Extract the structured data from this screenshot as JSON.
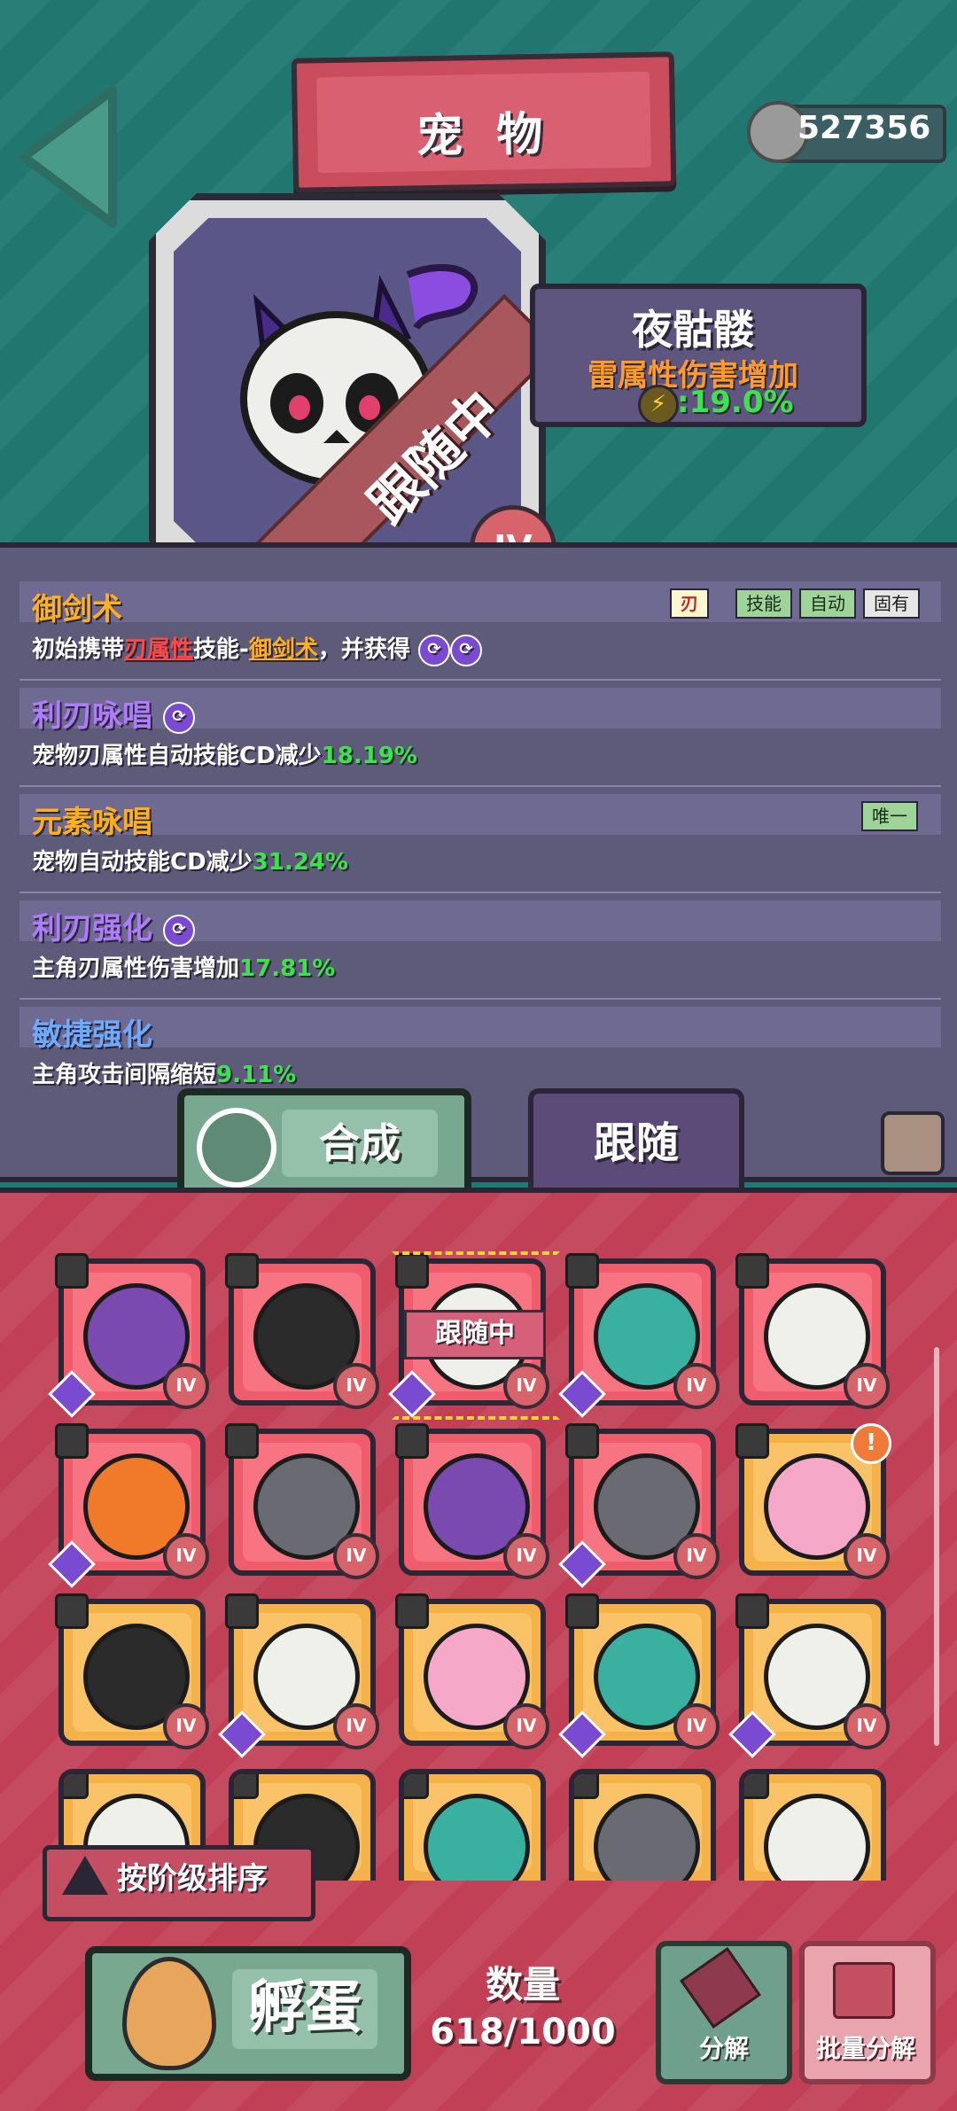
{
  "header": {
    "title": "宠 物",
    "coins": "527356"
  },
  "pet": {
    "name": "夜骷髅",
    "status_ribbon": "跟随中",
    "rank": "IV",
    "attribute_label": "雷属性伤害增加",
    "attribute_value": ":19.0%"
  },
  "skills": [
    {
      "name": "御剑术",
      "color": "#ffb020",
      "tags": [
        "刃",
        "技能",
        "自动",
        "固有"
      ],
      "desc_prefix": "初始携带",
      "desc_a": "刃属性",
      "desc_mid": "技能-",
      "desc_b": "御剑术",
      "desc_suffix": "，并获得"
    },
    {
      "name": "利刃咏唱",
      "color": "#b07cff",
      "desc_prefix": "宠物刃属性自动技能CD减少",
      "value": "18.19%"
    },
    {
      "name": "元素咏唱",
      "color": "#ffb020",
      "tags": [
        "唯一"
      ],
      "desc_prefix": "宠物自动技能CD减少",
      "value": "31.24%"
    },
    {
      "name": "利刃强化",
      "color": "#b07cff",
      "desc_prefix": "主角刃属性伤害增加",
      "value": "17.81%"
    },
    {
      "name": "敏捷强化",
      "color": "#6eaaff",
      "desc_prefix": "主角攻击间隔缩短",
      "value": "9.11%"
    }
  ],
  "actions": {
    "synthesize": "合成",
    "follow": "跟随"
  },
  "grid": {
    "following_label": "跟随中",
    "rank_label": "IV",
    "alert_mark": "!",
    "slots": [
      {
        "pet": "purple-dragon-icon",
        "bg": "red",
        "gem": true
      },
      {
        "pet": "sword-icon",
        "bg": "red",
        "gem": false
      },
      {
        "pet": "skull-icon",
        "bg": "red",
        "gem": true,
        "following": true
      },
      {
        "pet": "spring-creature-icon",
        "bg": "red",
        "gem": true
      },
      {
        "pet": "skull-icon",
        "bg": "red",
        "gem": false
      },
      {
        "pet": "pumpkin-icon",
        "bg": "red",
        "gem": true
      },
      {
        "pet": "drone-icon",
        "bg": "red",
        "gem": false
      },
      {
        "pet": "purple-dragon-icon",
        "bg": "red",
        "gem": false
      },
      {
        "pet": "drone-icon",
        "bg": "red",
        "gem": true
      },
      {
        "pet": "fairy-icon",
        "bg": "gold",
        "gem": false,
        "alert": true
      },
      {
        "pet": "sword-icon",
        "bg": "gold",
        "gem": false
      },
      {
        "pet": "skull-icon",
        "bg": "gold",
        "gem": true
      },
      {
        "pet": "fairy-icon",
        "bg": "gold",
        "gem": false
      },
      {
        "pet": "spring-creature-icon",
        "bg": "gold",
        "gem": true
      },
      {
        "pet": "skull-icon",
        "bg": "gold",
        "gem": true
      },
      {
        "pet": "skull-icon",
        "bg": "gold",
        "gem": false
      },
      {
        "pet": "sword-icon",
        "bg": "gold",
        "gem": false
      },
      {
        "pet": "spring-creature-icon",
        "bg": "gold",
        "gem": false
      },
      {
        "pet": "drone-icon",
        "bg": "gold",
        "gem": false
      },
      {
        "pet": "skull-icon",
        "bg": "gold",
        "gem": false
      }
    ]
  },
  "bottom": {
    "sort_label": "按阶级排序",
    "hatch_label": "孵蛋",
    "count_label": "数量",
    "count_value": "618/1000",
    "decompose_label": "分解",
    "batch_decompose_label": "批量分解"
  },
  "colors": {
    "teal_bg": "#237a74",
    "panel_purple": "#5e5a7a",
    "grid_red": "#c14055",
    "value_green": "#3ee24f"
  }
}
